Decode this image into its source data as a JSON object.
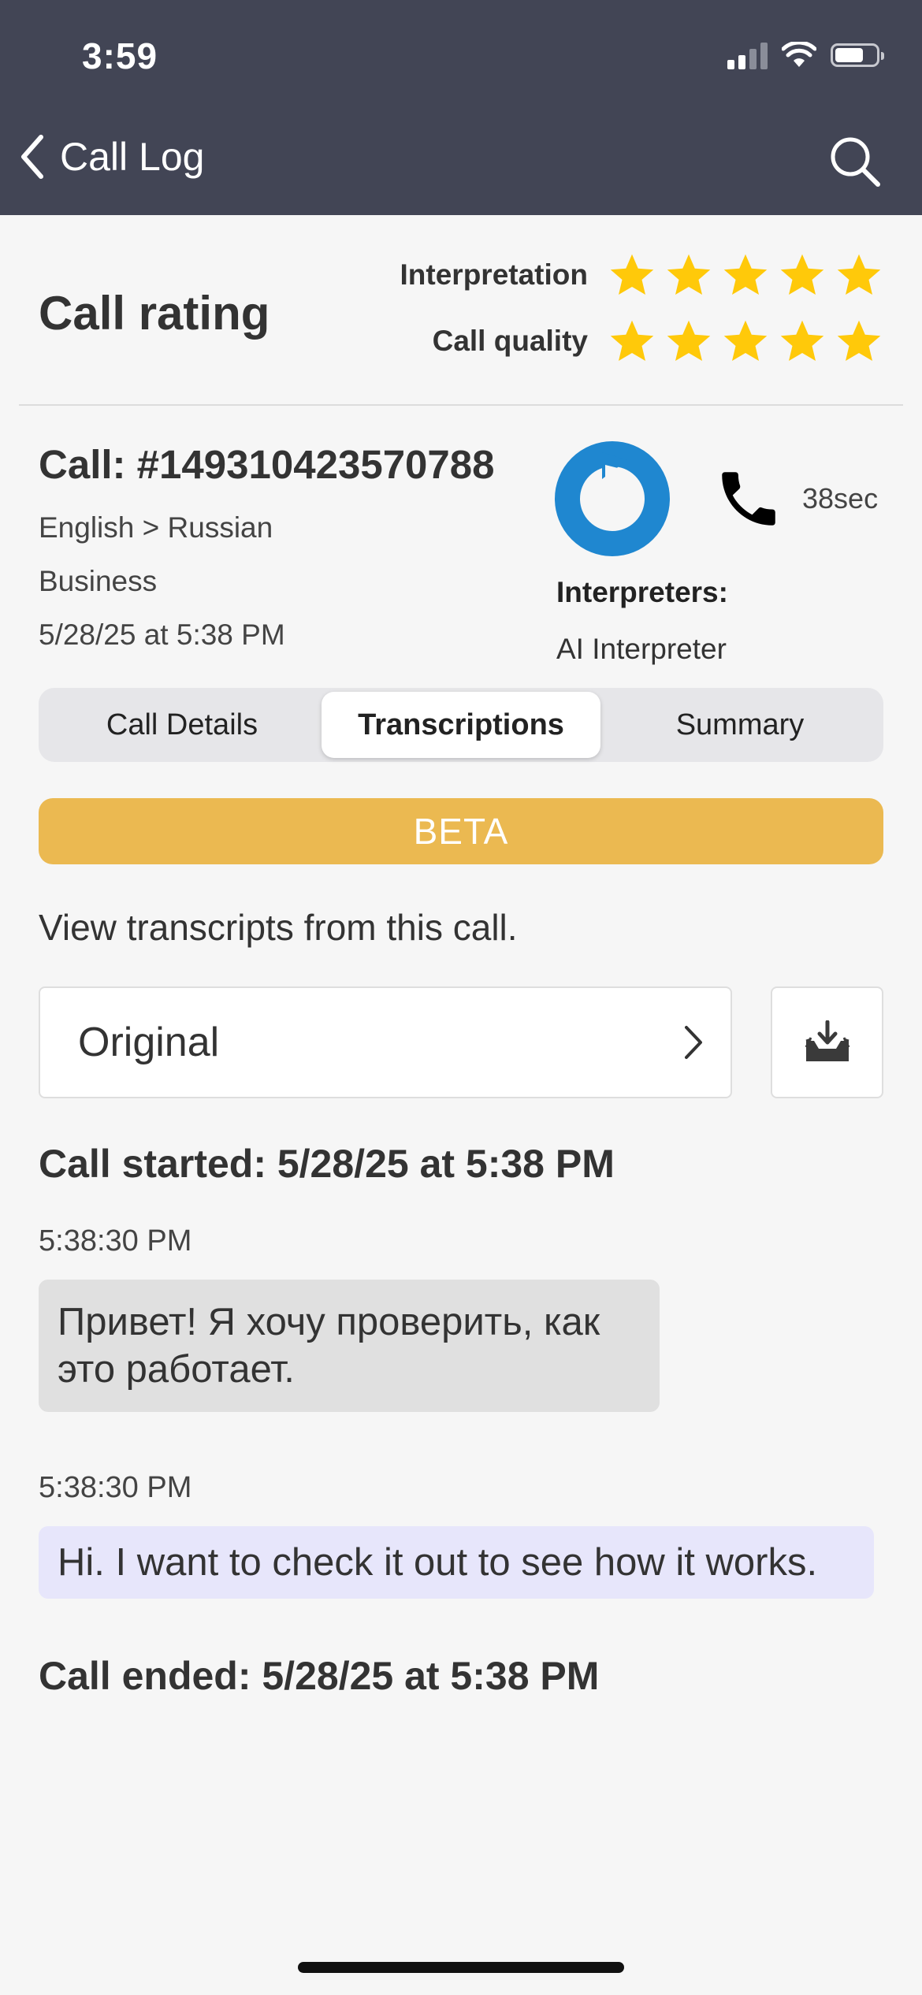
{
  "status_bar": {
    "time": "3:59",
    "battery_level": 0.7
  },
  "nav": {
    "back_label": "Call Log",
    "back_icon": "chevron-left-icon",
    "search_icon": "search-icon"
  },
  "rating": {
    "title": "Call rating",
    "rows": [
      {
        "label": "Interpretation",
        "stars": 5,
        "max": 5
      },
      {
        "label": "Call quality",
        "stars": 5,
        "max": 5
      }
    ],
    "star_color": "#ffc90a"
  },
  "call": {
    "id": "Call: #149310423570788",
    "languages": "English > Russian",
    "category": "Business",
    "datetime": "5/28/25 at 5:38 PM",
    "duration": "38sec",
    "interpreters_heading": "Interpreters:",
    "interpreter": "AI Interpreter",
    "logo_color": "#1f87d0"
  },
  "tabs": [
    {
      "label": "Call Details",
      "active": false
    },
    {
      "label": "Transcriptions",
      "active": true
    },
    {
      "label": "Summary",
      "active": false
    }
  ],
  "beta_label": "BETA",
  "beta_color": "#ebb951",
  "transcripts": {
    "intro": "View transcripts from this call.",
    "select_value": "Original",
    "download_icon": "download-tray-icon",
    "call_started": "Call started: 5/28/25 at 5:38 PM",
    "messages": [
      {
        "timestamp": "5:38:30 PM",
        "text": "Привет! Я хочу проверить, как это работает."
      },
      {
        "timestamp": "5:38:30 PM",
        "text": "Hi. I want to check it out to see how it works."
      }
    ],
    "call_ended": "Call ended: 5/28/25 at 5:38 PM"
  }
}
